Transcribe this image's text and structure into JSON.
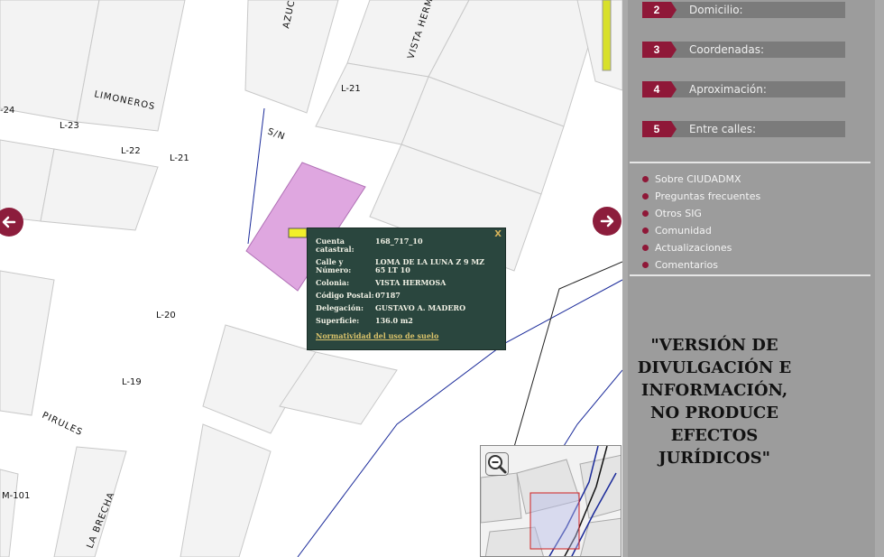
{
  "map": {
    "block_labels": [
      "-24",
      "L-23",
      "L-22",
      "L-21",
      "L-21",
      "L-20",
      "L-19",
      "M-101"
    ],
    "street_labels": [
      "LIMONEROS",
      "AZUCE",
      "VISTA HERMO",
      "S/N",
      "PIRULES",
      "LA BRECHA"
    ],
    "prev_icon": "arrow-left-icon",
    "next_icon": "arrow-right-icon",
    "highlight_color": "#dfa7e0",
    "accent_color": "#8c1d3c"
  },
  "popup": {
    "close_label": "X",
    "rows": [
      {
        "label": "Cuenta catastral:",
        "value": "168_717_10"
      },
      {
        "label": "Calle y Número:",
        "value": "LOMA DE LA LUNA Z 9 MZ 65 LT 10"
      },
      {
        "label": "Colonia:",
        "value": "VISTA HERMOSA"
      },
      {
        "label": "Código Postal:",
        "value": "07187"
      },
      {
        "label": "Delegación:",
        "value": "GUSTAVO A. MADERO"
      },
      {
        "label": "Superficie:",
        "value": "136.0 m2"
      }
    ],
    "link_label": "Normatividad del uso de suelo"
  },
  "minimap": {
    "zoom_icon": "zoom-out-icon"
  },
  "steps": [
    {
      "number": "2",
      "label": "Domicilio:"
    },
    {
      "number": "3",
      "label": "Coordenadas:"
    },
    {
      "number": "4",
      "label": "Aproximación:"
    },
    {
      "number": "5",
      "label": "Entre calles:"
    }
  ],
  "menu": [
    "Sobre CIUDADMX",
    "Preguntas frecuentes",
    "Otros SIG",
    "Comunidad",
    "Actualizaciones",
    "Comentarios"
  ],
  "disclaimer": "\"VERSIÓN DE DIVULGACIÓN E INFORMACIÓN, NO PRODUCE EFECTOS JURÍDICOS\""
}
